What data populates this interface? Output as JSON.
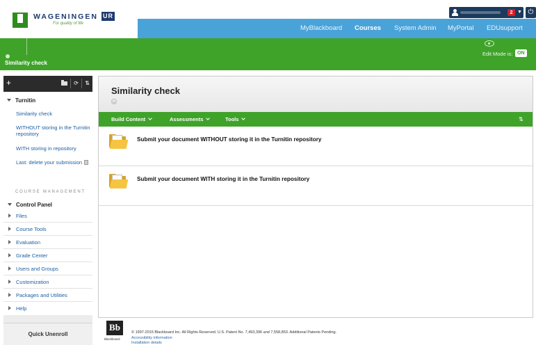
{
  "brand": {
    "name": "WAGENINGEN",
    "suffix": "UR",
    "tagline": "For quality of life"
  },
  "topnav": {
    "tabs": [
      {
        "label": "MyBlackboard",
        "active": false
      },
      {
        "label": "Courses",
        "active": true
      },
      {
        "label": "System Admin",
        "active": false
      },
      {
        "label": "MyPortal",
        "active": false
      },
      {
        "label": "EDUsupport",
        "active": false
      }
    ]
  },
  "userbar": {
    "notifications": "2",
    "caret": "▼",
    "power": "⏻"
  },
  "page_header": {
    "title": "Similarity check",
    "edit_mode_label": "Edit Mode is:",
    "edit_mode_value": "ON"
  },
  "sidebar": {
    "add": "+",
    "tools": [
      "⟳",
      "⇅"
    ],
    "section_title": "Turnitin",
    "links": [
      "Similarity check",
      "WITHOUT storing in the Turnitin repository",
      "WITH storing in repository",
      "Last: delete your submission"
    ],
    "course_management_label": "COURSE MANAGEMENT",
    "control_panel_label": "Control Panel",
    "control_panel_items": [
      "Files",
      "Course Tools",
      "Evaluation",
      "Grade Center",
      "Users and Groups",
      "Customization",
      "Packages and Utilities",
      "Help"
    ],
    "quick_unenroll": "Quick Unenroll"
  },
  "content": {
    "title": "Similarity check",
    "action_menus": [
      "Build Content",
      "Assessments",
      "Tools"
    ],
    "sort_icon": "⇅",
    "items": [
      {
        "title": "Submit your document WITHOUT storing it in the Turnitin repository"
      },
      {
        "title": "Submit your document WITH storing it in the Turnitin repository"
      }
    ]
  },
  "footer": {
    "logo": "Bb",
    "logo_caption": "Blackboard",
    "copyright": "© 1997-2015 Blackboard Inc. All Rights Reserved. U.S. Patent No. 7,493,396 and 7,558,853. Additional Patents Pending.",
    "links": [
      "Accessibility information",
      "Installation details"
    ]
  },
  "colors": {
    "brand_green": "#3fa32a",
    "nav_blue": "#4aa3d8",
    "navy": "#1c3a5c",
    "link_blue": "#1d5fa0",
    "folder_yellow": "#f5c542"
  }
}
